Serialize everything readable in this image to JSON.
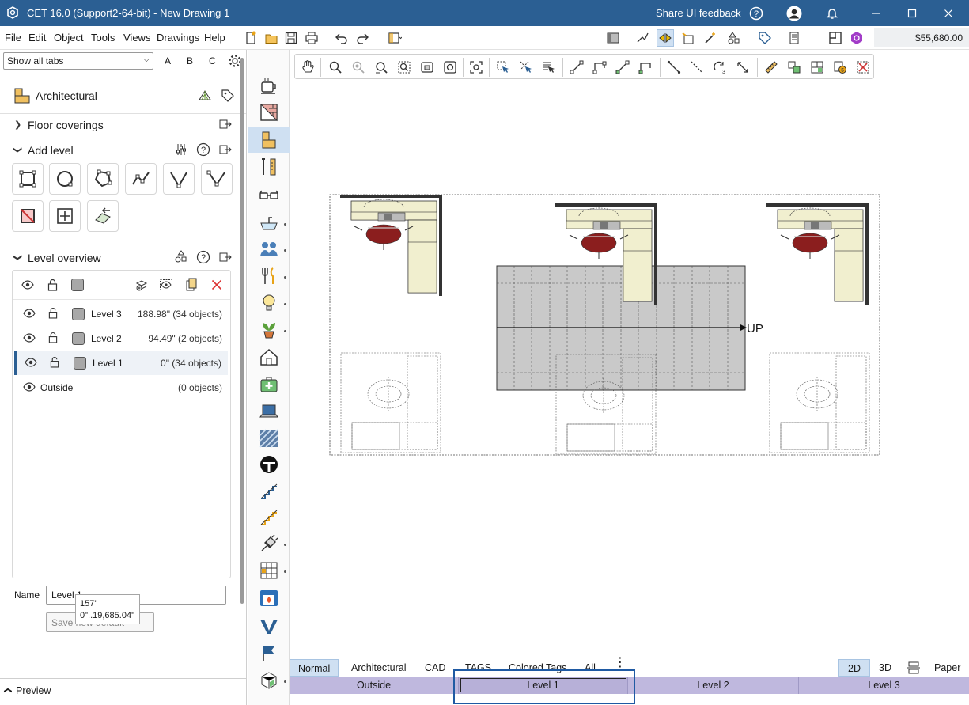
{
  "window": {
    "title": "CET 16.0 (Support2-64-bit) - New Drawing 1",
    "share_feedback": "Share UI feedback"
  },
  "menu": {
    "items": [
      "File",
      "Edit",
      "Object",
      "Tools",
      "Views",
      "Drawings",
      "Help"
    ],
    "price": "$55,680.00"
  },
  "left_panel": {
    "tabs_select": "Show all tabs",
    "letters": [
      "A",
      "B",
      "C"
    ],
    "category_title": "Architectural",
    "floor_coverings": "Floor coverings",
    "add_level": "Add level",
    "level_overview": "Level overview",
    "levels": [
      {
        "name": "Level 3",
        "info": "188.98\" (34 objects)"
      },
      {
        "name": "Level 2",
        "info": "94.49\" (2 objects)"
      },
      {
        "name": "Level 1",
        "info": "0\" (34 objects)"
      }
    ],
    "outside": {
      "name": "Outside",
      "info": "(0 objects)"
    },
    "name_label": "Name",
    "name_value": "Level 1",
    "save_button": "Save new default",
    "tooltip_line1": "157\"",
    "tooltip_line2": "0\"..19,685.04\"",
    "preview_label": "Preview"
  },
  "canvas": {
    "up_label": "UP"
  },
  "view_tabs": {
    "items": [
      "Normal",
      "Architectural",
      "CAD",
      "TAGS",
      "Colored Tags",
      "All"
    ],
    "right": [
      "2D",
      "3D",
      "Paper"
    ]
  },
  "level_bar": {
    "items": [
      "Outside",
      "Level 1",
      "Level 2",
      "Level 3"
    ]
  },
  "colors": {
    "titlebar": "#2b5f93",
    "level_bar": "#bfb8de",
    "highlight": "#1f5aa3",
    "counter": "#f1efcf",
    "chair": "#8b1e1e",
    "stairs": "#c9c9c9"
  }
}
